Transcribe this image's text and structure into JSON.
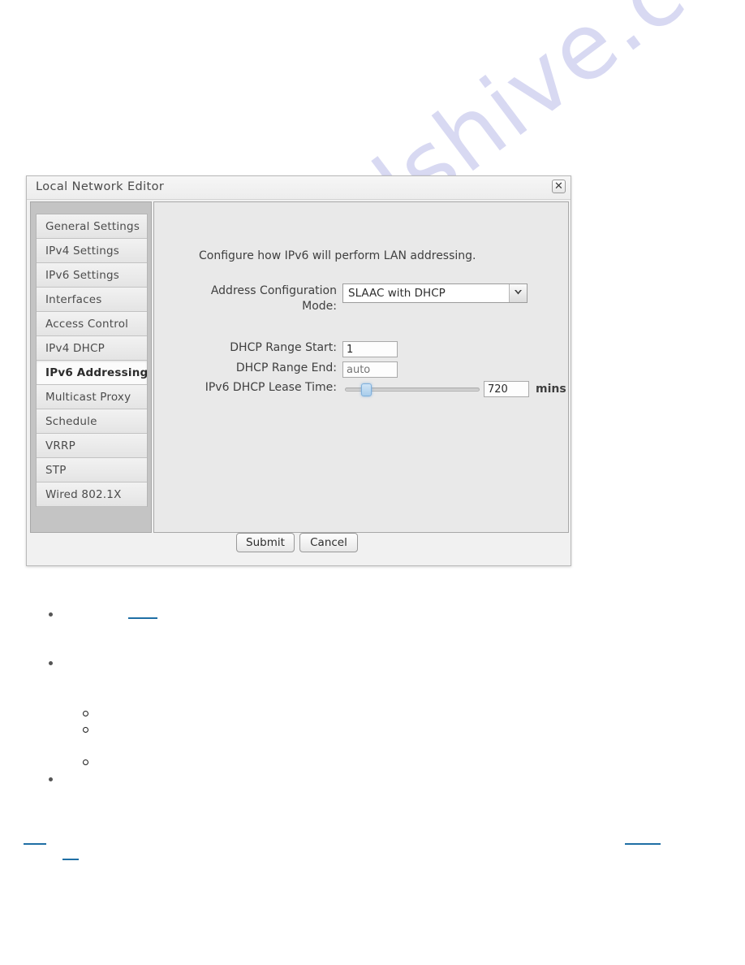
{
  "watermark": {
    "text": "manualshive.com"
  },
  "dialog": {
    "title": "Local Network Editor",
    "close_icon_glyph": "✕",
    "sidebar": {
      "items": [
        {
          "label": "General Settings",
          "selected": false
        },
        {
          "label": "IPv4 Settings",
          "selected": false
        },
        {
          "label": "IPv6 Settings",
          "selected": false
        },
        {
          "label": "Interfaces",
          "selected": false
        },
        {
          "label": "Access Control",
          "selected": false
        },
        {
          "label": "IPv4 DHCP",
          "selected": false
        },
        {
          "label": "IPv6 Addressing",
          "selected": true
        },
        {
          "label": "Multicast Proxy",
          "selected": false
        },
        {
          "label": "Schedule",
          "selected": false
        },
        {
          "label": "VRRP",
          "selected": false
        },
        {
          "label": "STP",
          "selected": false
        },
        {
          "label": "Wired 802.1X",
          "selected": false
        }
      ]
    },
    "content": {
      "description": "Configure how IPv6 will perform LAN addressing.",
      "fields": {
        "address_mode": {
          "label_line1": "Address Configuration",
          "label_line2": "Mode:",
          "value": "SLAAC with DHCP",
          "options": [
            "SLAAC with DHCP"
          ]
        },
        "dhcp_range_start": {
          "label": "DHCP Range Start:",
          "value": "1",
          "placeholder": "auto"
        },
        "dhcp_range_end": {
          "label": "DHCP Range End:",
          "value": "",
          "placeholder": "auto"
        },
        "lease_time": {
          "label": "IPv6 DHCP Lease Time:",
          "value": "720",
          "unit": "mins",
          "slider_percent": 13
        }
      }
    },
    "footer": {
      "submit_label": "Submit",
      "cancel_label": "Cancel"
    }
  },
  "colors": {
    "dialog_bg": "#f1f1f1",
    "panel_bg": "#e9e9e9",
    "sidebar_bg": "#c4c4c4",
    "link": "#1f6fa5",
    "watermark": "#d8d9f2",
    "slider_thumb": "#a9cdeb"
  }
}
